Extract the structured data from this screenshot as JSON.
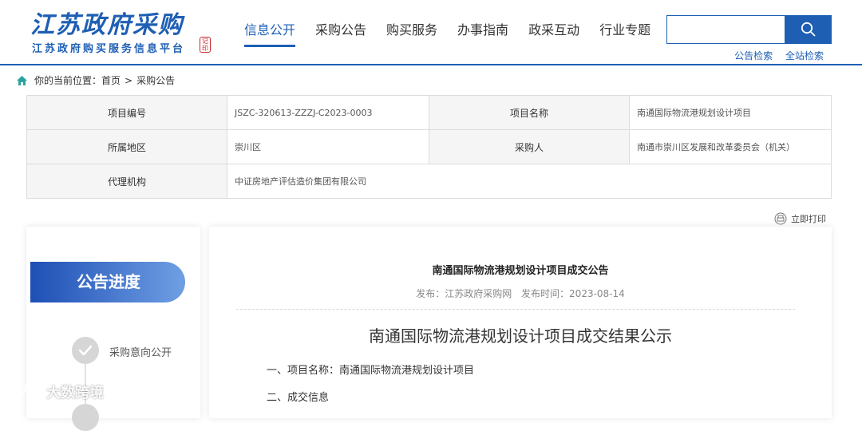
{
  "header": {
    "logo_title": "江苏政府采购",
    "logo_subtitle": "江苏政府购买服务信息平台",
    "logo_seal": "记印",
    "nav": [
      "信息公开",
      "采购公告",
      "购买服务",
      "办事指南",
      "政采互动",
      "行业专题"
    ],
    "active_nav": "信息公开",
    "search_placeholder": "",
    "quick_links": [
      "公告检索",
      "全站检索"
    ]
  },
  "breadcrumb": {
    "prefix": "你的当前位置：",
    "home": "首页",
    "separator": ">",
    "current": "采购公告"
  },
  "project_info": {
    "rows": [
      [
        "项目编号",
        "JSZC-320613-ZZZJ-C2023-0003",
        "项目名称",
        "南通国际物流港规划设计项目"
      ],
      [
        "所属地区",
        "崇川区",
        "采购人",
        "南通市崇川区发展和改革委员会（机关）"
      ],
      [
        "代理机构",
        "中证房地产评估造价集团有限公司",
        "",
        ""
      ]
    ]
  },
  "print_label": "立即打印",
  "sidebar": {
    "progress_title": "公告进度",
    "steps": [
      {
        "label": "采购意向公开",
        "done": true
      }
    ]
  },
  "article": {
    "title": "南通国际物流港规划设计项目成交公告",
    "publisher": "发布：江苏政府采购网",
    "publish_time": "发布时间：2023-08-14",
    "doc_title": "南通国际物流港规划设计项目成交结果公示",
    "paragraphs": [
      "一、项目名称：南通国际物流港规划设计项目",
      "二、成交信息"
    ]
  },
  "watermark": "大数跨境",
  "colors": {
    "primary": "#1e5fb4",
    "seal": "#c8282d"
  }
}
